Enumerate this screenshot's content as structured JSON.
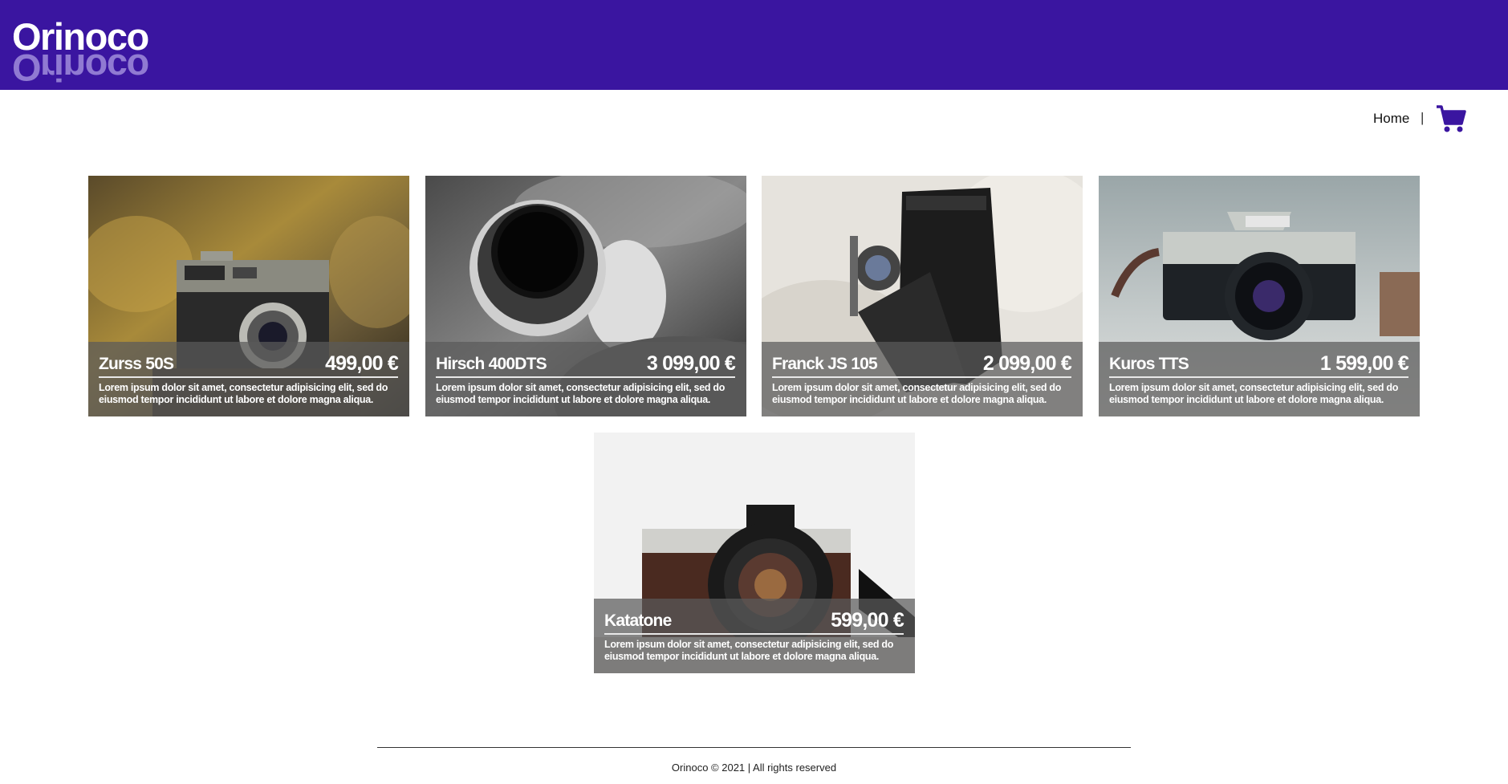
{
  "brand": {
    "name": "Orinoco",
    "primary_color": "#3a15a0"
  },
  "nav": {
    "home_label": "Home",
    "separator": "|",
    "cart_icon": "shopping-cart-icon"
  },
  "products": [
    {
      "name": "Zurss 50S",
      "price": "499,00 €",
      "description": "Lorem ipsum dolor sit amet, consectetur adipisicing elit, sed do eiusmod tempor incididunt ut labore et dolore magna aliqua."
    },
    {
      "name": "Hirsch 400DTS",
      "price": "3 099,00 €",
      "description": "Lorem ipsum dolor sit amet, consectetur adipisicing elit, sed do eiusmod tempor incididunt ut labore et dolore magna aliqua."
    },
    {
      "name": "Franck JS 105",
      "price": "2 099,00 €",
      "description": "Lorem ipsum dolor sit amet, consectetur adipisicing elit, sed do eiusmod tempor incididunt ut labore et dolore magna aliqua."
    },
    {
      "name": "Kuros TTS",
      "price": "1 599,00 €",
      "description": "Lorem ipsum dolor sit amet, consectetur adipisicing elit, sed do eiusmod tempor incididunt ut labore et dolore magna aliqua."
    },
    {
      "name": "Katatone",
      "price": "599,00 €",
      "description": "Lorem ipsum dolor sit amet, consectetur adipisicing elit, sed do eiusmod tempor incididunt ut labore et dolore magna aliqua."
    }
  ],
  "footer": {
    "text": "Orinoco © 2021 | All rights reserved"
  }
}
